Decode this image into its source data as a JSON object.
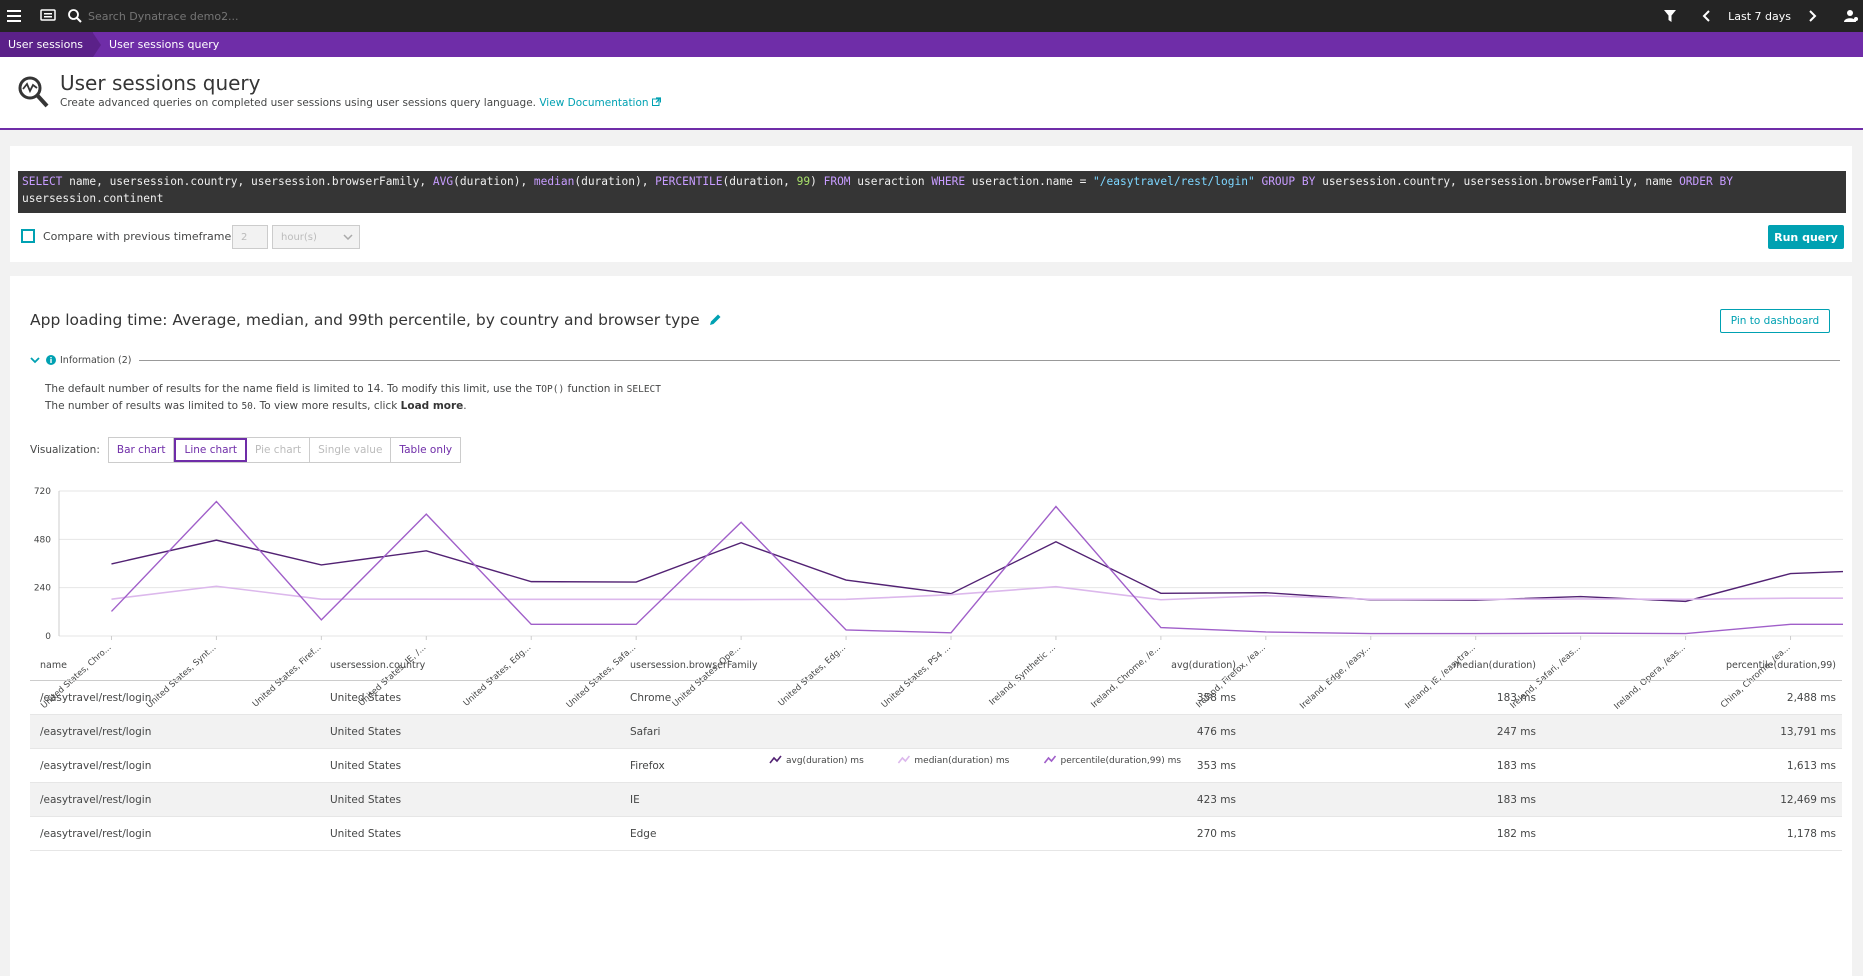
{
  "topbar": {
    "search_placeholder": "Search Dynatrace demo2...",
    "timeframe": "Last 7 days"
  },
  "breadcrumb": [
    "User sessions",
    "User sessions query"
  ],
  "header": {
    "title": "User sessions query",
    "subtitle": "Create advanced queries on completed user sessions using user sessions query language.",
    "doc_link": "View Documentation"
  },
  "query": {
    "compare_label": "Compare with previous timeframe",
    "compare_value": "2",
    "compare_unit": "hour(s)",
    "run_label": "Run query"
  },
  "result": {
    "title": "App loading time: Average, median, and 99th percentile, by country and browser type",
    "pin_label": "Pin to dashboard",
    "info_label": "Information (2)",
    "info_line1_a": "The default number of results for the name field is limited to 14. To modify this limit, use the",
    "info_line1_code": "TOP()",
    "info_line1_b": "function in",
    "info_line1_code2": "SELECT",
    "info_line2_a": "The number of results was limited to",
    "info_line2_code": "50",
    "info_line2_b": ". To view more results, click",
    "info_line2_bold": "Load more",
    "info_line2_c": ".",
    "viz_label": "Visualization:",
    "viz_options": [
      "Bar chart",
      "Line chart",
      "Pie chart",
      "Single value",
      "Table only"
    ]
  },
  "chart_data": {
    "type": "line",
    "categories": [
      "United States, Chro...",
      "United States, Synt...",
      "United States, Firef...",
      "United States, IE, /...",
      "United States, Edg...",
      "United States, Safa...",
      "United States, Ope...",
      "United States, Edg...",
      "United States, PS4 ...",
      "Ireland, Synthetic ...",
      "Ireland, Chrome, /e...",
      "Ireland, Firefox, /ea...",
      "Ireland, Edge, /easy...",
      "Ireland, IE, /easytra...",
      "Ireland, Safari, /eas...",
      "Ireland, Opera, /eas...",
      "China, Chrome, /ea..."
    ],
    "yticks": [
      0,
      240,
      480,
      720
    ],
    "ylim": [
      0,
      720
    ],
    "series": [
      {
        "name": "avg(duration) ms",
        "color": "#522273",
        "values": [
          358,
          476,
          353,
          423,
          270,
          268,
          463,
          278,
          210,
          468,
          212,
          215,
          180,
          178,
          196,
          172,
          310,
          320
        ]
      },
      {
        "name": "median(duration) ms",
        "color": "#dcb8ec",
        "values": [
          183,
          247,
          183,
          183,
          182,
          182,
          181,
          182,
          205,
          245,
          180,
          200,
          182,
          182,
          184,
          182,
          188,
          188
        ]
      },
      {
        "name": "percentile(duration,99) ms",
        "color": "#a05fc9",
        "values": [
          122,
          668,
          80,
          605,
          58,
          58,
          565,
          30,
          16,
          643,
          42,
          20,
          12,
          12,
          14,
          12,
          58,
          58
        ]
      }
    ]
  },
  "table": {
    "headers": [
      "name",
      "usersession.country",
      "usersession.browserFamily",
      "avg(duration)",
      "median(duration)",
      "percentile(duration,99)"
    ],
    "rows": [
      [
        "/easytravel/rest/login",
        "United States",
        "Chrome",
        "358 ms",
        "183 ms",
        "2,488 ms"
      ],
      [
        "/easytravel/rest/login",
        "United States",
        "Safari",
        "476 ms",
        "247 ms",
        "13,791 ms"
      ],
      [
        "/easytravel/rest/login",
        "United States",
        "Firefox",
        "353 ms",
        "183 ms",
        "1,613 ms"
      ],
      [
        "/easytravel/rest/login",
        "United States",
        "IE",
        "423 ms",
        "183 ms",
        "12,469 ms"
      ],
      [
        "/easytravel/rest/login",
        "United States",
        "Edge",
        "270 ms",
        "182 ms",
        "1,178 ms"
      ]
    ]
  }
}
